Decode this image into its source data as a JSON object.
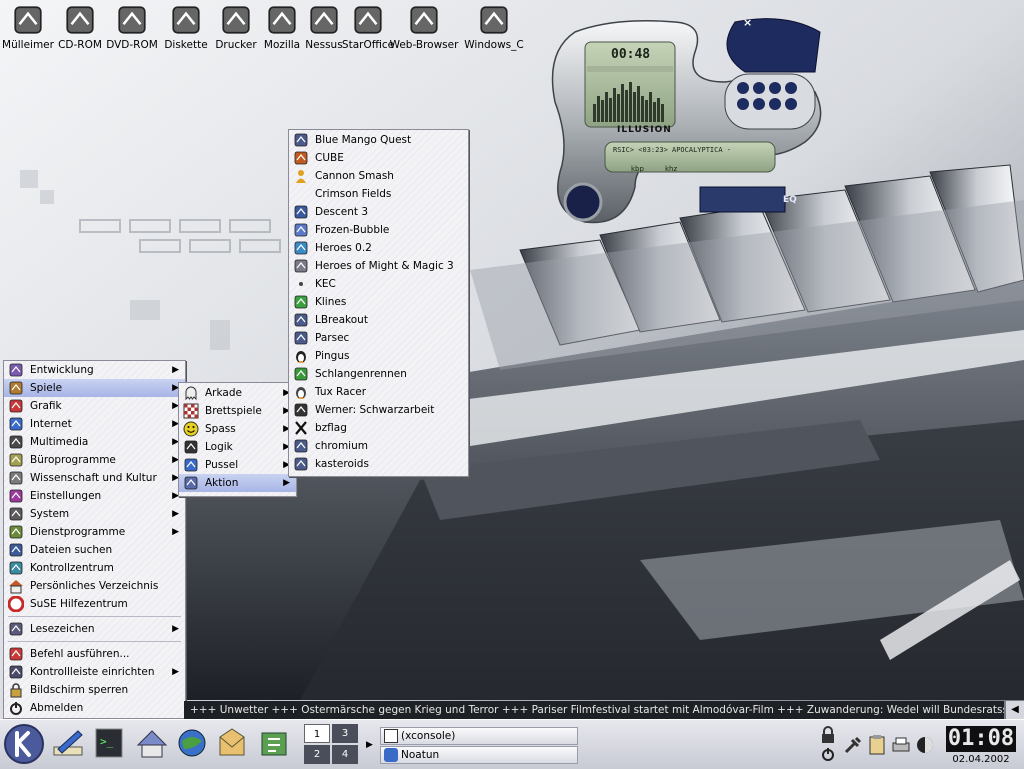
{
  "desktop_icons": [
    {
      "label": "Mülleimer",
      "icon": "trash-icon"
    },
    {
      "label": "CD-ROM",
      "icon": "cdrom-icon"
    },
    {
      "label": "DVD-ROM",
      "icon": "dvdrom-icon"
    },
    {
      "label": "Diskette",
      "icon": "floppy-icon"
    },
    {
      "label": "Drucker",
      "icon": "printer-icon"
    },
    {
      "label": "Mozilla",
      "icon": "mozilla-icon"
    },
    {
      "label": "Nessus",
      "icon": "nessus-icon"
    },
    {
      "label": "StarOffice",
      "icon": "staroffice-icon"
    },
    {
      "label": "Web-Browser",
      "icon": "globe-icon"
    },
    {
      "label": "Windows_C",
      "icon": "windows-drive-icon"
    }
  ],
  "kmenu": {
    "items": [
      {
        "label": "Entwicklung",
        "icon": "development-icon",
        "submenu": true
      },
      {
        "label": "Spiele",
        "icon": "games-icon",
        "submenu": true,
        "active": true
      },
      {
        "label": "Grafik",
        "icon": "graphics-icon",
        "submenu": true
      },
      {
        "label": "Internet",
        "icon": "internet-icon",
        "submenu": true
      },
      {
        "label": "Multimedia",
        "icon": "multimedia-icon",
        "submenu": true
      },
      {
        "label": "Büroprogramme",
        "icon": "office-icon",
        "submenu": true
      },
      {
        "label": "Wissenschaft und Kultur",
        "icon": "science-icon",
        "submenu": true
      },
      {
        "label": "Einstellungen",
        "icon": "settings-icon",
        "submenu": true
      },
      {
        "label": "System",
        "icon": "system-icon",
        "submenu": true
      },
      {
        "label": "Dienstprogramme",
        "icon": "utilities-icon",
        "submenu": true
      },
      {
        "label": "Dateien suchen",
        "icon": "find-files-icon"
      },
      {
        "label": "Kontrollzentrum",
        "icon": "control-center-icon"
      },
      {
        "label": "Persönliches Verzeichnis",
        "icon": "home-folder-icon"
      },
      {
        "label": "SuSE Hilfezentrum",
        "icon": "help-icon"
      }
    ],
    "lower_items": [
      {
        "label": "Lesezeichen",
        "icon": "bookmarks-icon",
        "submenu": true
      }
    ],
    "bottom_items": [
      {
        "label": "Befehl ausführen...",
        "icon": "run-command-icon"
      },
      {
        "label": "Kontrollleiste einrichten",
        "icon": "configure-panel-icon",
        "submenu": true
      },
      {
        "label": "Bildschirm sperren",
        "icon": "lock-screen-icon"
      },
      {
        "label": "Abmelden",
        "icon": "logout-icon"
      }
    ]
  },
  "games_menu": {
    "items": [
      {
        "label": "Arkade",
        "icon": "ghost-icon"
      },
      {
        "label": "Brettspiele",
        "icon": "chessboard-icon"
      },
      {
        "label": "Spass",
        "icon": "smiley-icon"
      },
      {
        "label": "Logik",
        "icon": "bomb-icon"
      },
      {
        "label": "Pussel",
        "icon": "puzzle-icon"
      },
      {
        "label": "Aktion",
        "icon": "action-icon",
        "active": true
      }
    ]
  },
  "action_menu": {
    "items": [
      {
        "label": "Blue Mango Quest",
        "icon": "game-icon"
      },
      {
        "label": "CUBE",
        "icon": "cube-icon"
      },
      {
        "label": "Cannon Smash",
        "icon": "person-icon"
      },
      {
        "label": "Crimson Fields",
        "icon": "blank-icon"
      },
      {
        "label": "Descent 3",
        "icon": "descent-icon"
      },
      {
        "label": "Frozen-Bubble",
        "icon": "penguin-bubble-icon"
      },
      {
        "label": "Heroes 0.2",
        "icon": "heroes-icon"
      },
      {
        "label": "Heroes of Might & Magic 3",
        "icon": "shield-icon"
      },
      {
        "label": "KEC",
        "icon": "dot-icon"
      },
      {
        "label": "Klines",
        "icon": "klines-icon"
      },
      {
        "label": "LBreakout",
        "icon": "game-icon"
      },
      {
        "label": "Parsec",
        "icon": "game-icon"
      },
      {
        "label": "Pingus",
        "icon": "penguin-icon"
      },
      {
        "label": "Schlangenrennen",
        "icon": "snake-icon"
      },
      {
        "label": "Tux Racer",
        "icon": "tux-racer-icon"
      },
      {
        "label": "Werner: Schwarzarbeit",
        "icon": "werner-icon"
      },
      {
        "label": "bzflag",
        "icon": "x-icon"
      },
      {
        "label": "chromium",
        "icon": "game-icon"
      },
      {
        "label": "kasteroids",
        "icon": "game-icon"
      }
    ]
  },
  "player": {
    "time": "00:48",
    "title": "ILLUSION",
    "track": "RSIC> <03:23> APOCALYPTICA -",
    "kbps": "kbp",
    "khz": "khz",
    "eq": "EQ"
  },
  "ticker": {
    "text": "+++ Unwetter +++ Ostermärsche gegen Krieg und Terror +++ Pariser Filmfestival startet mit Almodóvar-Film +++ Zuwanderung: Wedel will Bundesratssitzung verfilmen +++ Isr"
  },
  "panel": {
    "pager": [
      "1",
      "3",
      "2",
      "4"
    ],
    "tasks": [
      {
        "label": "(xconsole)",
        "icon": "console-icon"
      },
      {
        "label": "Noatun",
        "icon": "noatun-icon"
      }
    ],
    "clock_time": "01:08",
    "clock_date": "02.04.2002"
  },
  "colors": {
    "menu_highlight": "#b3bfec",
    "ticker_bg": "#1d2024",
    "panel_bg": "#d4d6de"
  }
}
